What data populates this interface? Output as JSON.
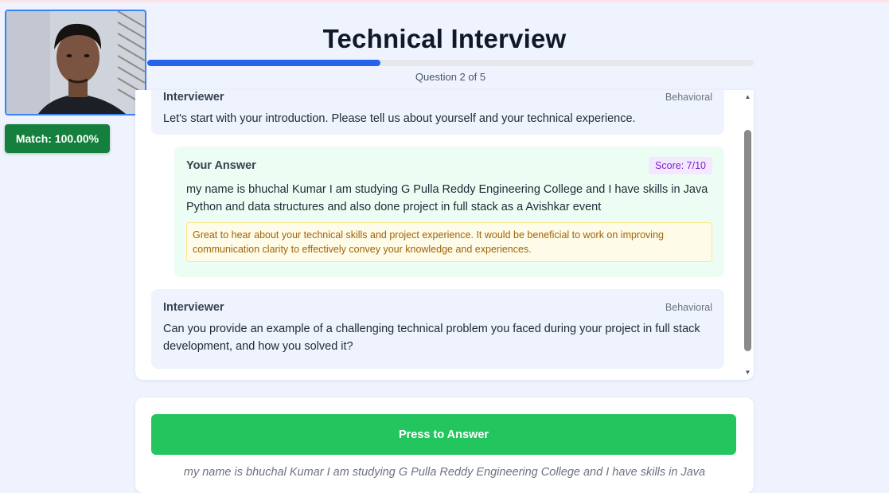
{
  "header": {
    "title": "Technical Interview",
    "progress": {
      "current": 2,
      "total": 5,
      "fraction": 0.385,
      "label": "Question 2 of 5"
    }
  },
  "webcam": {
    "match_label": "Match: 100.00%"
  },
  "conversation": [
    {
      "role": "interviewer",
      "sender": "Interviewer",
      "tag": "Behavioral",
      "text": "Let's start with your introduction. Please tell us about yourself and your technical experience."
    },
    {
      "role": "answer",
      "sender": "Your Answer",
      "score": "Score: 7/10",
      "text": "my name is bhuchal Kumar I am studying G Pulla Reddy Engineering College and I have skills in Java Python and data structures and also done project in full stack as a Avishkar event",
      "feedback": "Great to hear about your technical skills and project experience. It would be beneficial to work on improving communication clarity to effectively convey your knowledge and experiences."
    },
    {
      "role": "interviewer",
      "sender": "Interviewer",
      "tag": "Behavioral",
      "text": "Can you provide an example of a challenging technical problem you faced during your project in full stack development, and how you solved it?"
    }
  ],
  "answer_panel": {
    "button_label": "Press to Answer",
    "transcript": "my name is bhuchal Kumar I am studying G Pulla Reddy Engineering College and I have skills in Java"
  },
  "colors": {
    "accent": "#2563eb",
    "answer_button": "#22c55e",
    "match_badge": "#15803d",
    "score_text": "#7e22ce",
    "feedback_text": "#a16207"
  },
  "icons": {
    "scroll_up": "scroll-up-arrow-icon",
    "scroll_down": "scroll-down-arrow-icon"
  }
}
